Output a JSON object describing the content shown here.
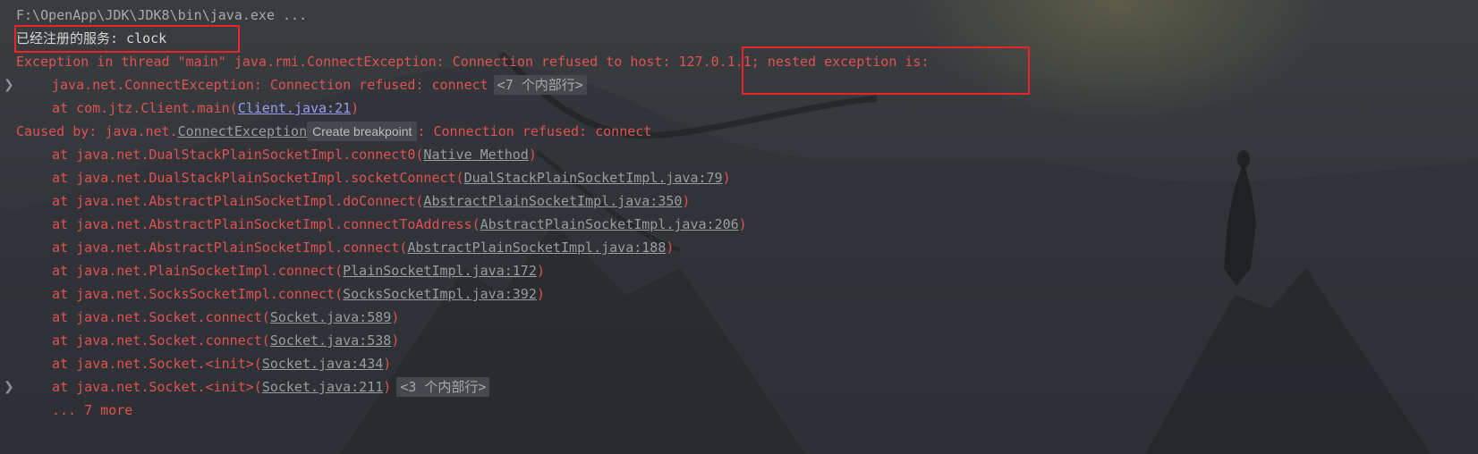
{
  "console": {
    "cmd_line": "F:\\OpenApp\\JDK\\JDK8\\bin\\java.exe ...",
    "registered_service_line": "已经注册的服务: clock",
    "exception_line": "Exception in thread \"main\" java.rmi.ConnectException: Connection refused to host: 127.0.1.1; nested exception is:",
    "nested_exception_text": "java.net.ConnectException: Connection refused: connect",
    "internal_frames_badge_1": "<7 个内部行>",
    "client_frame": {
      "prefix": "at com.jtz.Client.main(",
      "link": "Client.java:21",
      "suffix": ")"
    },
    "caused_by": {
      "prefix": "Caused by: java.net.",
      "link": "ConnectException",
      "tooltip": "Create breakpoint",
      "suffix": ": Connection refused: connect"
    },
    "stack_frames": [
      {
        "prefix": "at java.net.DualStackPlainSocketImpl.connect0(",
        "link": "Native Method",
        "suffix": ")"
      },
      {
        "prefix": "at java.net.DualStackPlainSocketImpl.socketConnect(",
        "link": "DualStackPlainSocketImpl.java:79",
        "suffix": ")"
      },
      {
        "prefix": "at java.net.AbstractPlainSocketImpl.doConnect(",
        "link": "AbstractPlainSocketImpl.java:350",
        "suffix": ")"
      },
      {
        "prefix": "at java.net.AbstractPlainSocketImpl.connectToAddress(",
        "link": "AbstractPlainSocketImpl.java:206",
        "suffix": ")"
      },
      {
        "prefix": "at java.net.AbstractPlainSocketImpl.connect(",
        "link": "AbstractPlainSocketImpl.java:188",
        "suffix": ")"
      },
      {
        "prefix": "at java.net.PlainSocketImpl.connect(",
        "link": "PlainSocketImpl.java:172",
        "suffix": ")"
      },
      {
        "prefix": "at java.net.SocksSocketImpl.connect(",
        "link": "SocksSocketImpl.java:392",
        "suffix": ")"
      },
      {
        "prefix": "at java.net.Socket.connect(",
        "link": "Socket.java:589",
        "suffix": ")"
      },
      {
        "prefix": "at java.net.Socket.connect(",
        "link": "Socket.java:538",
        "suffix": ")"
      },
      {
        "prefix": "at java.net.Socket.<init>(",
        "link": "Socket.java:434",
        "suffix": ")"
      }
    ],
    "last_frame": {
      "prefix": "at java.net.Socket.<init>(",
      "link": "Socket.java:211",
      "suffix": ")"
    },
    "internal_frames_badge_2": "<3 个内部行>",
    "more_line": "... 7 more",
    "chevron_icon": "chevron-right-icon",
    "colors": {
      "error": "#e05252",
      "highlight_box": "#e8262a",
      "link_blue": "#9a9bf2"
    }
  }
}
